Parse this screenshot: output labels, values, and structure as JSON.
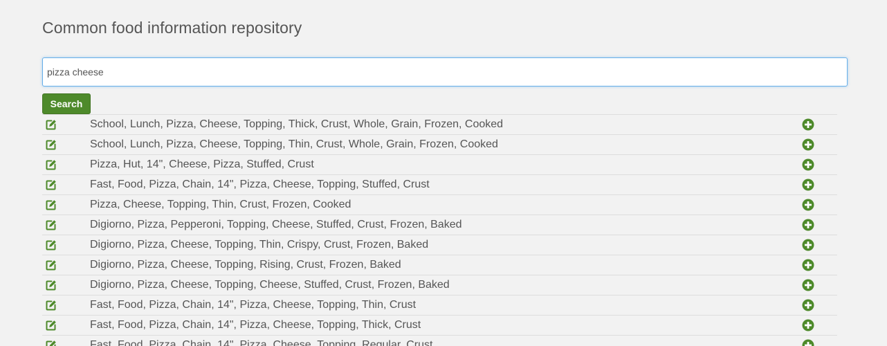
{
  "page": {
    "title": "Common food information repository"
  },
  "search": {
    "value": "pizza cheese",
    "button_label": "Search"
  },
  "results": [
    {
      "label": "School, Lunch, Pizza, Cheese, Topping, Thick, Crust, Whole, Grain, Frozen, Cooked"
    },
    {
      "label": "School, Lunch, Pizza, Cheese, Topping, Thin, Crust, Whole, Grain, Frozen, Cooked"
    },
    {
      "label": "Pizza, Hut, 14\", Cheese, Pizza, Stuffed, Crust"
    },
    {
      "label": "Fast, Food, Pizza, Chain, 14\", Pizza, Cheese, Topping, Stuffed, Crust"
    },
    {
      "label": "Pizza, Cheese, Topping, Thin, Crust, Frozen, Cooked"
    },
    {
      "label": "Digiorno, Pizza, Pepperoni, Topping, Cheese, Stuffed, Crust, Frozen, Baked"
    },
    {
      "label": "Digiorno, Pizza, Cheese, Topping, Thin, Crispy, Crust, Frozen, Baked"
    },
    {
      "label": "Digiorno, Pizza, Cheese, Topping, Rising, Crust, Frozen, Baked"
    },
    {
      "label": "Digiorno, Pizza, Cheese, Topping, Cheese, Stuffed, Crust, Frozen, Baked"
    },
    {
      "label": "Fast, Food, Pizza, Chain, 14\", Pizza, Cheese, Topping, Thin, Crust"
    },
    {
      "label": "Fast, Food, Pizza, Chain, 14\", Pizza, Cheese, Topping, Thick, Crust"
    },
    {
      "label": "Fast, Food, Pizza, Chain, 14\", Pizza, Cheese, Topping, Regular, Crust"
    }
  ],
  "icons": {
    "edit": "edit-icon",
    "add": "plus-circle-icon"
  },
  "colors": {
    "background": "#f2f2f2",
    "accent_green": "#4e8a2b",
    "text": "#555555",
    "focus_border": "#66afe9"
  }
}
